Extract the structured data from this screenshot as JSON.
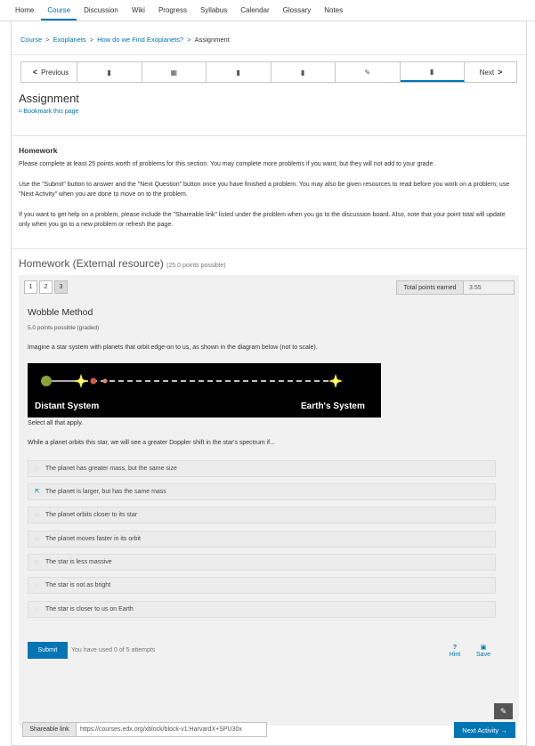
{
  "topnav": {
    "tabs": [
      "Home",
      "Course",
      "Discussion",
      "Wiki",
      "Progress",
      "Syllabus",
      "Calendar",
      "Glossary",
      "Notes"
    ],
    "active": "Course"
  },
  "breadcrumb": {
    "items": [
      "Course",
      "Exoplanets",
      "How do we Find Exoplanets?"
    ],
    "current": "Assignment",
    "separator": ">"
  },
  "sequence": {
    "prev_label": "Previous",
    "next_label": "Next",
    "units": [
      {
        "icon": "book-icon",
        "glyph": "▮"
      },
      {
        "icon": "film-icon",
        "glyph": "▦"
      },
      {
        "icon": "book-icon",
        "glyph": "▮"
      },
      {
        "icon": "book-icon",
        "glyph": "▮"
      },
      {
        "icon": "edit-icon",
        "glyph": "✎"
      },
      {
        "icon": "book-icon",
        "glyph": "▮",
        "active": true
      }
    ]
  },
  "page": {
    "title": "Assignment",
    "bookmark_label": "Bookmark this page"
  },
  "homework": {
    "heading": "Homework",
    "p1": "Please complete at least 25 points worth of problems for this section. You may complete more problems if you want, but they will not add to your grade.",
    "p2": "Use the \"Submit\" button to answer and the \"Next Question\" button once you have finished a problem. You may also be given resources to read before you work on a problem; use \"Next Activity\" when you are done to move on to the problem.",
    "p3": "If you want to get help on a problem, please include the \"Shareable link\" listed under the problem when you go to the discussion board. Also, note that your point total will update only when you go to a new problem or refresh the page."
  },
  "external": {
    "title": "Homework (External resource)",
    "points_possible": "(25.0 points possible)",
    "pages": [
      "1",
      "2",
      "3"
    ],
    "current_page": "3",
    "total_points_label": "Total points earned",
    "total_points_value": "3.55"
  },
  "problem": {
    "title": "Wobble Method",
    "points": "5.0 points possible (graded)",
    "intro": "Imagine a star system with planets that orbit edge-on to us, as shown in the diagram below (not to scale).",
    "diagram_left_label": "Distant System",
    "diagram_right_label": "Earth's System",
    "select_all": "Select all that apply.",
    "question": "While a planet orbits this star, we will see a greater Doppler shift in the star's spectrum if...",
    "choices": [
      "The planet has greater mass, but the same size",
      "The planet is larger, but has the same mass",
      "The planet orbits closer to its star",
      "The planet moves faster in its orbit",
      "The star is less massive",
      "The star is not as bright",
      "The star is closer to us on Earth"
    ],
    "submit_label": "Submit",
    "attempts": "You have used 0 of 5 attempts",
    "hint_label": "Hint",
    "save_label": "Save"
  },
  "footer": {
    "shareable_label": "Shareable link",
    "shareable_url": "https://courses.edx.org/xblock/block-v1:HarvardX+SPU30x",
    "next_activity_label": "Next Activity →"
  },
  "colors": {
    "accent": "#0075b4",
    "panel_gray": "#f1f1f1",
    "diagram_bg": "#000000",
    "star_yellow": "#ffee33",
    "planet_green": "#8aa23a",
    "planet_red": "#d45a4a"
  }
}
